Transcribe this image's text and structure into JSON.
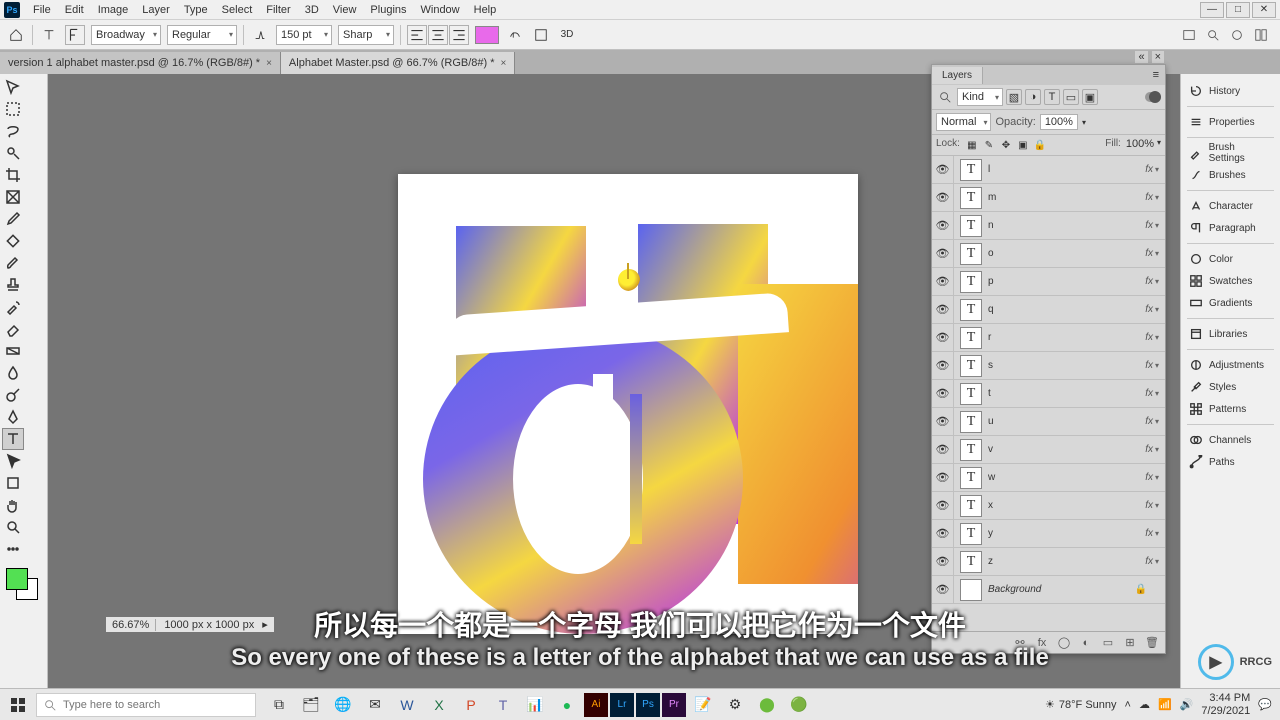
{
  "menu": [
    "File",
    "Edit",
    "Image",
    "Layer",
    "Type",
    "Select",
    "Filter",
    "3D",
    "View",
    "Plugins",
    "Window",
    "Help"
  ],
  "options": {
    "font_family": "Broadway",
    "font_style": "Regular",
    "font_size": "150 pt",
    "aa": "Sharp",
    "threeD": "3D"
  },
  "tabs": [
    {
      "label": "version 1 alphabet master.psd @ 16.7% (RGB/8#) *",
      "active": false
    },
    {
      "label": "Alphabet Master.psd @ 66.7% (RGB/8#) *",
      "active": true
    }
  ],
  "status": {
    "zoom": "66.67%",
    "dims": "1000 px x 1000 px"
  },
  "layersPanel": {
    "title": "Layers",
    "filterKind": "Kind",
    "blend": "Normal",
    "opacityLabel": "Opacity:",
    "opacity": "100%",
    "lockLabel": "Lock:",
    "fillLabel": "Fill:",
    "fill": "100%",
    "items": [
      {
        "name": "l",
        "fx": true
      },
      {
        "name": "m",
        "fx": true
      },
      {
        "name": "n",
        "fx": true
      },
      {
        "name": "o",
        "fx": true
      },
      {
        "name": "p",
        "fx": true
      },
      {
        "name": "q",
        "fx": true
      },
      {
        "name": "r",
        "fx": true
      },
      {
        "name": "s",
        "fx": true
      },
      {
        "name": "t",
        "fx": true
      },
      {
        "name": "u",
        "fx": true
      },
      {
        "name": "v",
        "fx": true
      },
      {
        "name": "w",
        "fx": true
      },
      {
        "name": "x",
        "fx": true
      },
      {
        "name": "y",
        "fx": true
      },
      {
        "name": "z",
        "fx": true
      }
    ],
    "background": "Background"
  },
  "rightPanels": [
    "History",
    "Properties",
    "Brush Settings",
    "Brushes",
    "Character",
    "Paragraph",
    "Color",
    "Swatches",
    "Gradients",
    "Libraries",
    "Adjustments",
    "Styles",
    "Patterns",
    "Channels",
    "Paths"
  ],
  "subtitle": {
    "cn": "所以每一个都是一个字母 我们可以把它作为一个文件",
    "en": "So every one of these is a letter of the alphabet that we can use as a file"
  },
  "watermark": "RRCG",
  "taskbar": {
    "search_placeholder": "Type here to search",
    "weather": "78°F  Sunny",
    "time": "3:44 PM",
    "date": "7/29/2021"
  },
  "colors": {
    "accent": "#e86aea",
    "fg": "#53e053"
  }
}
